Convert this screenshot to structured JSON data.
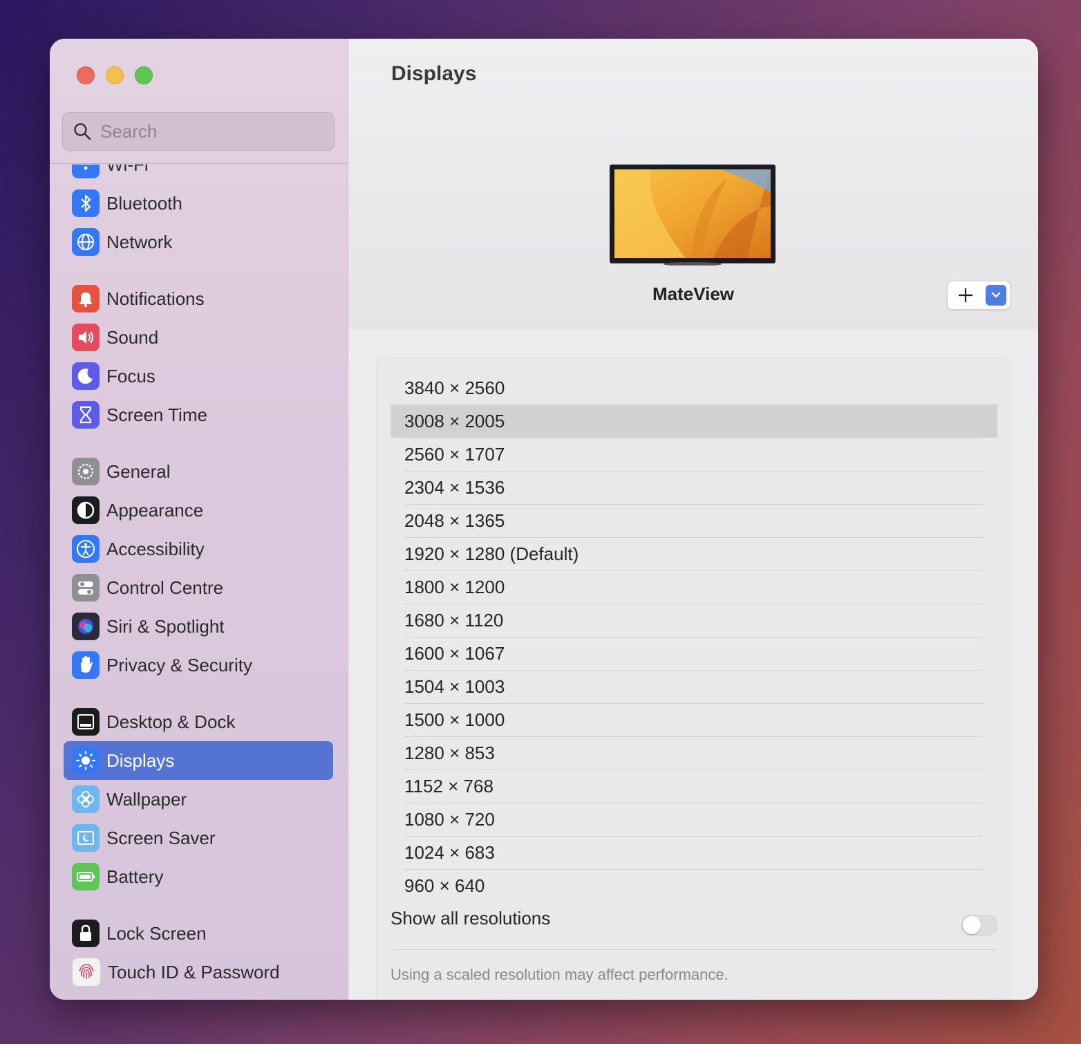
{
  "window": {
    "traffic_lights": [
      "close",
      "minimize",
      "zoom"
    ]
  },
  "sidebar": {
    "search_placeholder": "Search",
    "items": [
      {
        "label": "Wi-Fi",
        "icon": "wifi-icon",
        "color": "#3478f6"
      },
      {
        "label": "Bluetooth",
        "icon": "bluetooth-icon",
        "color": "#3478f6"
      },
      {
        "label": "Network",
        "icon": "globe-icon",
        "color": "#3478f6"
      },
      {
        "label": "Notifications",
        "icon": "bell-icon",
        "color": "#e5533f"
      },
      {
        "label": "Sound",
        "icon": "speaker-icon",
        "color": "#e24c5c"
      },
      {
        "label": "Focus",
        "icon": "moon-icon",
        "color": "#5e5ce6"
      },
      {
        "label": "Screen Time",
        "icon": "hourglass-icon",
        "color": "#5e5ce6"
      },
      {
        "label": "General",
        "icon": "gear-icon",
        "color": "#8e8e93"
      },
      {
        "label": "Appearance",
        "icon": "appearance-icon",
        "color": "#1c1c1e"
      },
      {
        "label": "Accessibility",
        "icon": "accessibility-icon",
        "color": "#3478f6"
      },
      {
        "label": "Control Centre",
        "icon": "switches-icon",
        "color": "#8e8e93"
      },
      {
        "label": "Siri & Spotlight",
        "icon": "siri-icon",
        "color": "#2a2a3a"
      },
      {
        "label": "Privacy & Security",
        "icon": "hand-icon",
        "color": "#3478f6"
      },
      {
        "label": "Desktop & Dock",
        "icon": "dock-icon",
        "color": "#1c1c1e"
      },
      {
        "label": "Displays",
        "icon": "brightness-icon",
        "color": "#3478f6",
        "active": true
      },
      {
        "label": "Wallpaper",
        "icon": "flower-icon",
        "color": "#6fb6ee"
      },
      {
        "label": "Screen Saver",
        "icon": "screensaver-icon",
        "color": "#6fb6ee"
      },
      {
        "label": "Battery",
        "icon": "battery-icon",
        "color": "#5fc45a"
      },
      {
        "label": "Lock Screen",
        "icon": "lock-icon",
        "color": "#1c1c1e"
      },
      {
        "label": "Touch ID & Password",
        "icon": "fingerprint-icon",
        "color": "#f2f2f2"
      }
    ]
  },
  "main": {
    "title": "Displays",
    "display_name": "MateView",
    "add_button_label": "+",
    "resolutions": [
      "3840 × 2560",
      "3008 × 2005",
      "2560 × 1707",
      "2304 × 1536",
      "2048 × 1365",
      "1920 × 1280 (Default)",
      "1800 × 1200",
      "1680 × 1120",
      "1600 × 1067",
      "1504 × 1003",
      "1500 × 1000",
      "1280 × 853",
      "1152 × 768",
      "1080 × 720",
      "1024 × 683",
      "960 × 640"
    ],
    "selected_resolution": "3008 × 2005",
    "show_all_label": "Show all resolutions",
    "show_all_enabled": false,
    "note": "Using a scaled resolution may affect performance."
  }
}
